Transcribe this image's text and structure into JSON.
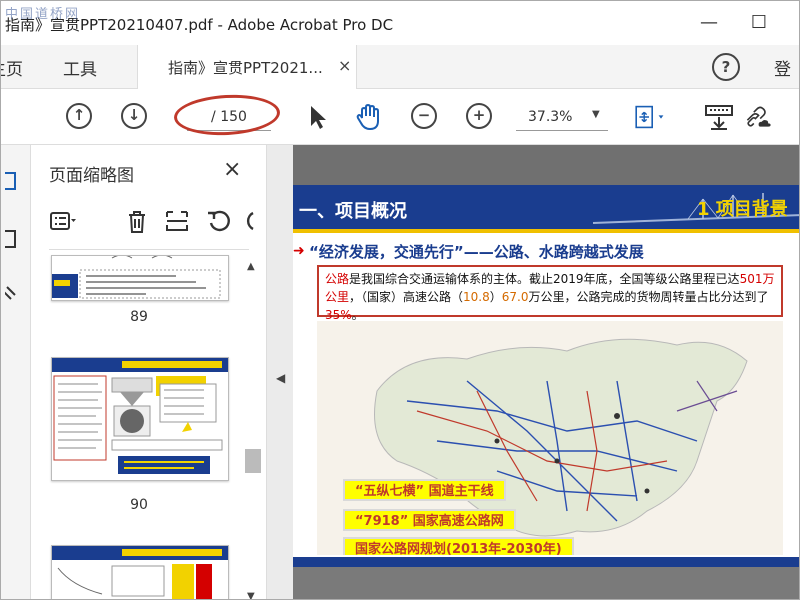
{
  "window": {
    "watermark": "中国道桥网",
    "title": "指南》宣贯PPT20210407.pdf - Adobe Acrobat Pro DC",
    "minimize": "—",
    "maximize": "☐"
  },
  "menubar": {
    "home": "主页",
    "tools": "工具",
    "doc_tab": "指南》宣贯PPT2021...",
    "tab_close": "×",
    "help": "?",
    "signin": "登"
  },
  "toolbar": {
    "page_current": "",
    "page_total": "/ 150",
    "zoom": "37.3%"
  },
  "thumbnails": {
    "title": "页面缩略图",
    "close": "×",
    "pages": [
      {
        "num": "89"
      },
      {
        "num": "90"
      },
      {
        "num": ""
      }
    ]
  },
  "slide": {
    "title": "一、项目概况",
    "section": "1 项目背景",
    "subtitle": "“经济发展，交通先行”——公路、水路跨越式发展",
    "info_parts": {
      "p1": "公路",
      "p2": "是我国综合交通运输体系的主体。截止2019年底，全国等级公路里程已达",
      "p3": "501万公里",
      "p4": "，（国家）高速公路（",
      "p5": "10.8",
      "p6": "）",
      "p7": "67.0",
      "p8": "万公里，公路完成的货物周转量占比分达到了",
      "p9": "35%",
      "p10": "。"
    },
    "legend": [
      "“五纵七横” 国道主干线",
      "“7918” 国家高速公路网",
      "国家公路网规划(2013年-2030年)"
    ]
  },
  "colors": {
    "slide_blue": "#1a3d8f",
    "slide_yellow": "#f2d200",
    "annotation_red": "#c0392b",
    "accent_red": "#d40000"
  }
}
